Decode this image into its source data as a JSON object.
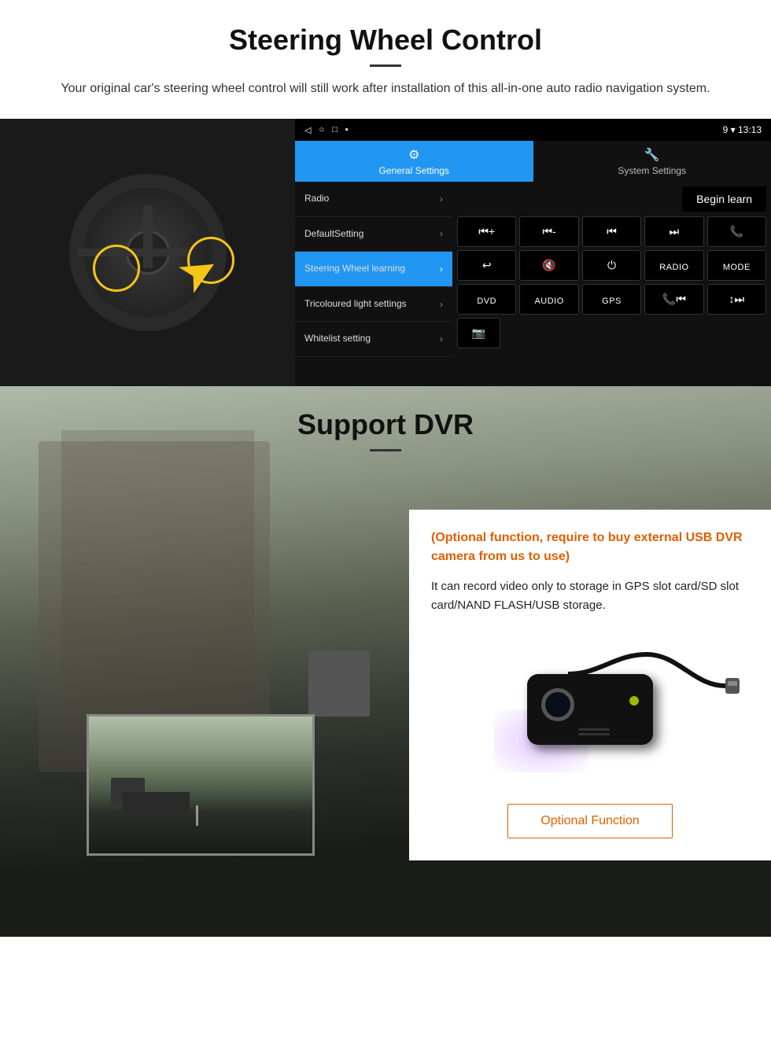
{
  "page": {
    "section1": {
      "title": "Steering Wheel Control",
      "description": "Your original car's steering wheel control will still work after installation of this all-in-one auto radio navigation system."
    },
    "android": {
      "statusbar": {
        "time": "13:13",
        "icons": [
          "◁",
          "○",
          "□",
          "▪"
        ]
      },
      "tabs": [
        {
          "label": "General Settings",
          "active": true
        },
        {
          "label": "System Settings",
          "active": false
        }
      ],
      "menu_items": [
        {
          "label": "Radio",
          "active": false
        },
        {
          "label": "DefaultSetting",
          "active": false
        },
        {
          "label": "Steering Wheel learning",
          "active": true
        },
        {
          "label": "Tricoloured light settings",
          "active": false
        },
        {
          "label": "Whitelist setting",
          "active": false
        }
      ],
      "begin_learn_label": "Begin learn",
      "control_rows": [
        [
          "⏮+",
          "⏮-",
          "⏮",
          "⏭",
          "📞"
        ],
        [
          "↩",
          "🔇x",
          "⏻",
          "RADIO",
          "MODE"
        ],
        [
          "DVD",
          "AUDIO",
          "GPS",
          "📞⏮",
          "↕⏭"
        ],
        [
          "📷"
        ]
      ]
    },
    "section2": {
      "title": "Support DVR",
      "info_orange": "(Optional function, require to buy external USB DVR camera from us to use)",
      "info_text": "It can record video only to storage in GPS slot card/SD slot card/NAND FLASH/USB storage.",
      "optional_function_label": "Optional Function"
    }
  }
}
